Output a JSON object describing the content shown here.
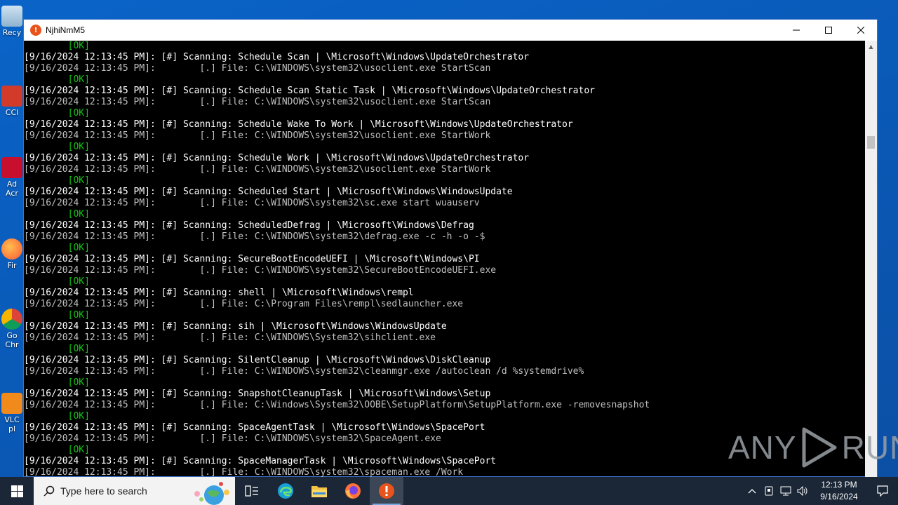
{
  "desktop": {
    "icons": [
      {
        "label": "Recy"
      },
      {
        "label": "CCl"
      },
      {
        "label": "Ad Acr"
      },
      {
        "label": "Fir"
      },
      {
        "label": "Go Chr"
      },
      {
        "label": "VLC pl"
      }
    ]
  },
  "window": {
    "title": "NjhiNmM5",
    "icon_glyph": "!"
  },
  "console": {
    "colors": {
      "text": "#c0c0c0",
      "highlight": "#ffffff",
      "ok": "#13c613"
    },
    "lines": [
      {
        "t": "        [OK]",
        "k": "ok"
      },
      {
        "t": "[9/16/2024 12:13:45 PM]: [#] Scanning: Schedule Scan | \\Microsoft\\Windows\\UpdateOrchestrator",
        "k": "hl"
      },
      {
        "t": "[9/16/2024 12:13:45 PM]:        [.] File: C:\\WINDOWS\\system32\\usoclient.exe StartScan",
        "k": "n"
      },
      {
        "t": "        [OK]",
        "k": "ok"
      },
      {
        "t": "[9/16/2024 12:13:45 PM]: [#] Scanning: Schedule Scan Static Task | \\Microsoft\\Windows\\UpdateOrchestrator",
        "k": "hl"
      },
      {
        "t": "[9/16/2024 12:13:45 PM]:        [.] File: C:\\WINDOWS\\system32\\usoclient.exe StartScan",
        "k": "n"
      },
      {
        "t": "        [OK]",
        "k": "ok"
      },
      {
        "t": "[9/16/2024 12:13:45 PM]: [#] Scanning: Schedule Wake To Work | \\Microsoft\\Windows\\UpdateOrchestrator",
        "k": "hl"
      },
      {
        "t": "[9/16/2024 12:13:45 PM]:        [.] File: C:\\WINDOWS\\system32\\usoclient.exe StartWork",
        "k": "n"
      },
      {
        "t": "        [OK]",
        "k": "ok"
      },
      {
        "t": "[9/16/2024 12:13:45 PM]: [#] Scanning: Schedule Work | \\Microsoft\\Windows\\UpdateOrchestrator",
        "k": "hl"
      },
      {
        "t": "[9/16/2024 12:13:45 PM]:        [.] File: C:\\WINDOWS\\system32\\usoclient.exe StartWork",
        "k": "n"
      },
      {
        "t": "        [OK]",
        "k": "ok"
      },
      {
        "t": "[9/16/2024 12:13:45 PM]: [#] Scanning: Scheduled Start | \\Microsoft\\Windows\\WindowsUpdate",
        "k": "hl"
      },
      {
        "t": "[9/16/2024 12:13:45 PM]:        [.] File: C:\\WINDOWS\\system32\\sc.exe start wuauserv",
        "k": "n"
      },
      {
        "t": "        [OK]",
        "k": "ok"
      },
      {
        "t": "[9/16/2024 12:13:45 PM]: [#] Scanning: ScheduledDefrag | \\Microsoft\\Windows\\Defrag",
        "k": "hl"
      },
      {
        "t": "[9/16/2024 12:13:45 PM]:        [.] File: C:\\WINDOWS\\system32\\defrag.exe -c -h -o -$",
        "k": "n"
      },
      {
        "t": "        [OK]",
        "k": "ok"
      },
      {
        "t": "[9/16/2024 12:13:45 PM]: [#] Scanning: SecureBootEncodeUEFI | \\Microsoft\\Windows\\PI",
        "k": "hl"
      },
      {
        "t": "[9/16/2024 12:13:45 PM]:        [.] File: C:\\WINDOWS\\system32\\SecureBootEncodeUEFI.exe",
        "k": "n"
      },
      {
        "t": "        [OK]",
        "k": "ok"
      },
      {
        "t": "[9/16/2024 12:13:45 PM]: [#] Scanning: shell | \\Microsoft\\Windows\\rempl",
        "k": "hl"
      },
      {
        "t": "[9/16/2024 12:13:45 PM]:        [.] File: C:\\Program Files\\rempl\\sedlauncher.exe",
        "k": "n"
      },
      {
        "t": "        [OK]",
        "k": "ok"
      },
      {
        "t": "[9/16/2024 12:13:45 PM]: [#] Scanning: sih | \\Microsoft\\Windows\\WindowsUpdate",
        "k": "hl"
      },
      {
        "t": "[9/16/2024 12:13:45 PM]:        [.] File: C:\\WINDOWS\\System32\\sihclient.exe",
        "k": "n"
      },
      {
        "t": "        [OK]",
        "k": "ok"
      },
      {
        "t": "[9/16/2024 12:13:45 PM]: [#] Scanning: SilentCleanup | \\Microsoft\\Windows\\DiskCleanup",
        "k": "hl"
      },
      {
        "t": "[9/16/2024 12:13:45 PM]:        [.] File: C:\\WINDOWS\\system32\\cleanmgr.exe /autoclean /d %systemdrive%",
        "k": "n"
      },
      {
        "t": "        [OK]",
        "k": "ok"
      },
      {
        "t": "[9/16/2024 12:13:45 PM]: [#] Scanning: SnapshotCleanupTask | \\Microsoft\\Windows\\Setup",
        "k": "hl"
      },
      {
        "t": "[9/16/2024 12:13:45 PM]:        [.] File: C:\\Windows\\System32\\OOBE\\SetupPlatform\\SetupPlatform.exe -removesnapshot",
        "k": "n"
      },
      {
        "t": "        [OK]",
        "k": "ok"
      },
      {
        "t": "[9/16/2024 12:13:45 PM]: [#] Scanning: SpaceAgentTask | \\Microsoft\\Windows\\SpacePort",
        "k": "hl"
      },
      {
        "t": "[9/16/2024 12:13:45 PM]:        [.] File: C:\\WINDOWS\\system32\\SpaceAgent.exe",
        "k": "n"
      },
      {
        "t": "        [OK]",
        "k": "ok"
      },
      {
        "t": "[9/16/2024 12:13:45 PM]: [#] Scanning: SpaceManagerTask | \\Microsoft\\Windows\\SpacePort",
        "k": "hl"
      },
      {
        "t": "[9/16/2024 12:13:45 PM]:        [.] File: C:\\WINDOWS\\system32\\spaceman.exe /Work",
        "k": "n"
      }
    ]
  },
  "watermark": {
    "left": "ANY",
    "right": "RUN"
  },
  "taskbar": {
    "search_placeholder": "Type here to search",
    "clock_time": "12:13 PM",
    "clock_date": "9/16/2024"
  }
}
